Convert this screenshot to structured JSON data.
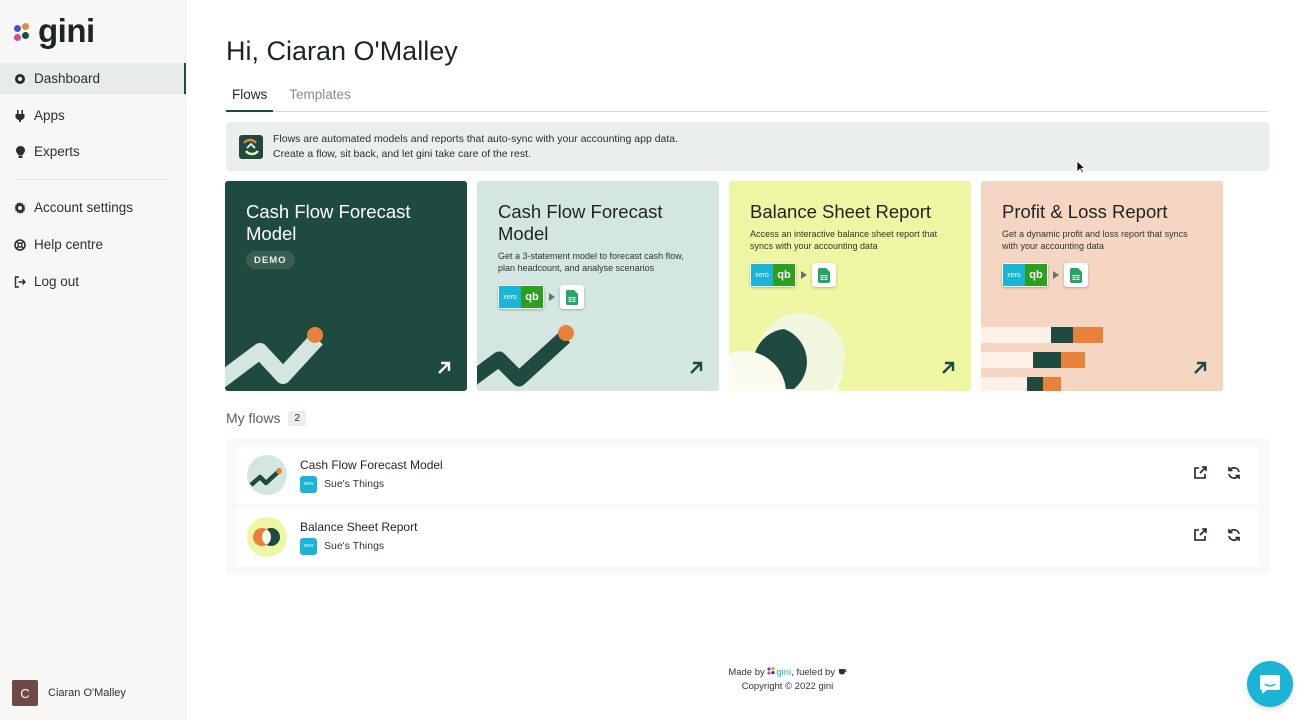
{
  "brand": {
    "name": "gini",
    "dot_colors": [
      "#3a58c9",
      "#e88b3c",
      "#1e4a3f",
      "#d84c8f"
    ]
  },
  "sidebar": {
    "items": [
      {
        "label": "Dashboard",
        "icon": "target-icon",
        "active": true
      },
      {
        "label": "Apps",
        "icon": "plug-icon"
      },
      {
        "label": "Experts",
        "icon": "lightbulb-icon"
      }
    ],
    "bottom_items": [
      {
        "label": "Account settings",
        "icon": "gear-icon"
      },
      {
        "label": "Help centre",
        "icon": "lifebuoy-icon"
      },
      {
        "label": "Log out",
        "icon": "logout-icon"
      }
    ],
    "user": {
      "initial": "C",
      "name": "Ciaran O'Malley"
    }
  },
  "header": {
    "greeting": "Hi, Ciaran O'Malley"
  },
  "tabs": [
    {
      "label": "Flows",
      "active": true
    },
    {
      "label": "Templates"
    }
  ],
  "info": {
    "line1": "Flows are automated models and reports that auto-sync with your accounting app data.",
    "line2": "Create a flow, sit back, and let gini take care of the rest."
  },
  "cards": [
    {
      "title": "Cash Flow Forecast Model",
      "badge": "DEMO",
      "bg": "#1e4a3f"
    },
    {
      "title": "Cash Flow Forecast Model",
      "desc": "Get a 3-statement model to forecast cash flow, plan headcount, and analyse scenarios",
      "bg": "#d3e6df"
    },
    {
      "title": "Balance Sheet Report",
      "desc": "Access an interactive balance sheet report that syncs with your accounting data",
      "bg": "#eef5a3"
    },
    {
      "title": "Profit & Loss Report",
      "desc": "Get a dynamic profit and loss report that syncs with your accounting data",
      "bg": "#f4d6c2"
    }
  ],
  "chips": {
    "xero": "xero",
    "qb": "qb"
  },
  "my_flows": {
    "title": "My flows",
    "count": "2",
    "rows": [
      {
        "name": "Cash Flow Forecast Model",
        "org": "Sue's Things"
      },
      {
        "name": "Balance Sheet Report",
        "org": "Sue's Things"
      }
    ]
  },
  "footer": {
    "made_by": "Made by",
    "brand": "gini",
    "fueled_by": ", fueled by",
    "copyright": "Copyright © 2022 gini"
  },
  "colors": {
    "accent": "#1e4a3f",
    "orange": "#e8823a",
    "chat": "#1ab4d7"
  }
}
